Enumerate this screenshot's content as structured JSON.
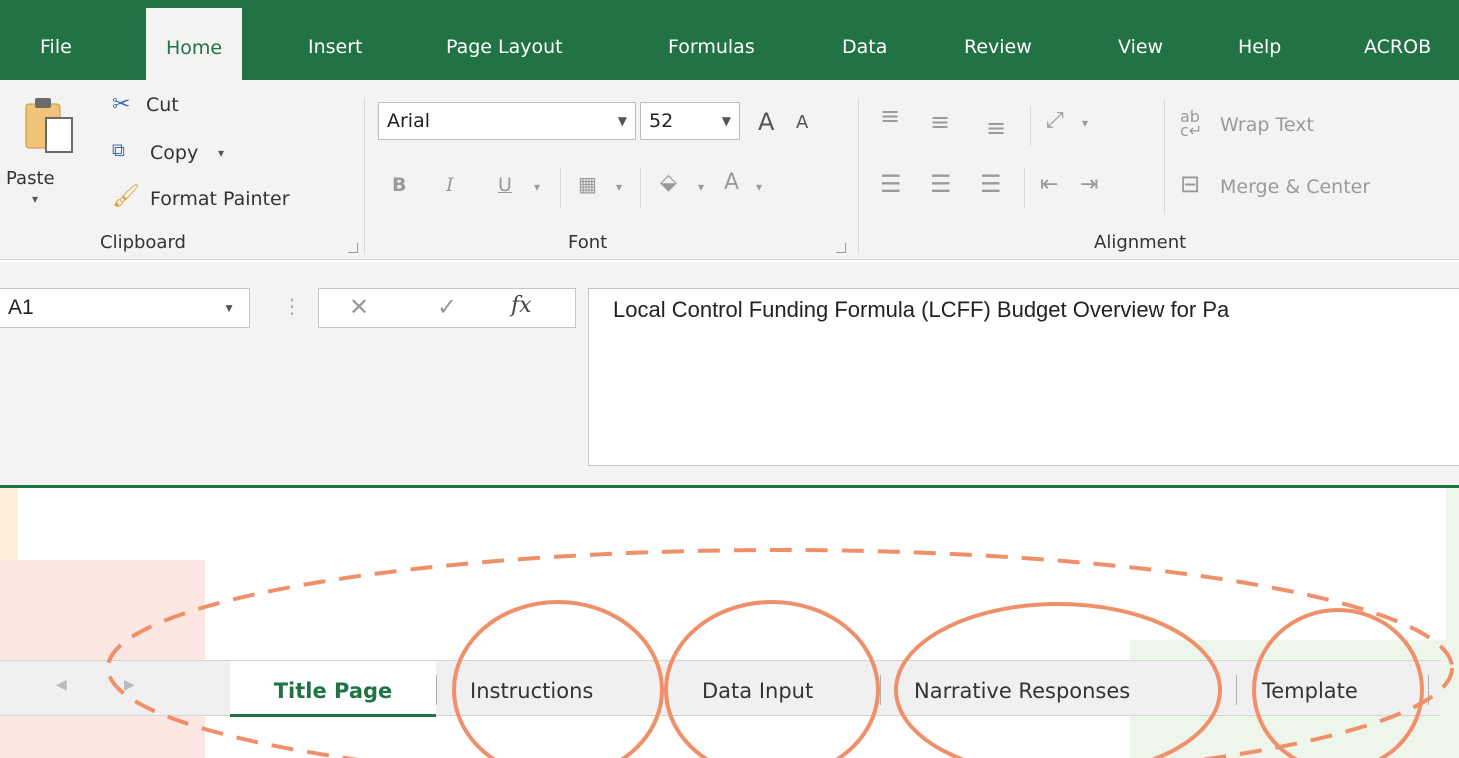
{
  "ribbon_tabs": [
    "File",
    "Home",
    "Insert",
    "Page Layout",
    "Formulas",
    "Data",
    "Review",
    "View",
    "Help",
    "ACROB"
  ],
  "active_tab": "Home",
  "clipboard": {
    "paste": "Paste",
    "cut": "Cut",
    "copy": "Copy",
    "format_painter": "Format Painter",
    "group_label": "Clipboard"
  },
  "font": {
    "name": "Arial",
    "size": "52",
    "bold": "B",
    "italic": "I",
    "underline": "U",
    "color_letter": "A",
    "grow": "A",
    "shrink": "A",
    "group_label": "Font"
  },
  "alignment": {
    "wrap_text": "Wrap Text",
    "merge_center": "Merge & Center",
    "group_label": "Alignment"
  },
  "formula_bar": {
    "name_box": "A1",
    "fx": "fx",
    "content": "Local Control Funding Formula (LCFF) Budget Overview for Pa"
  },
  "sheet_tabs": [
    "Title Page",
    "Instructions",
    "Data Input",
    "Narrative Responses",
    "Template"
  ],
  "active_sheet": "Title Page",
  "colors": {
    "excel_green": "#217346",
    "annotation_orange": "#f0906a",
    "deco_yellow": "#fdf0d8",
    "deco_pink": "#fde7e3",
    "deco_green": "#eef5ea"
  }
}
